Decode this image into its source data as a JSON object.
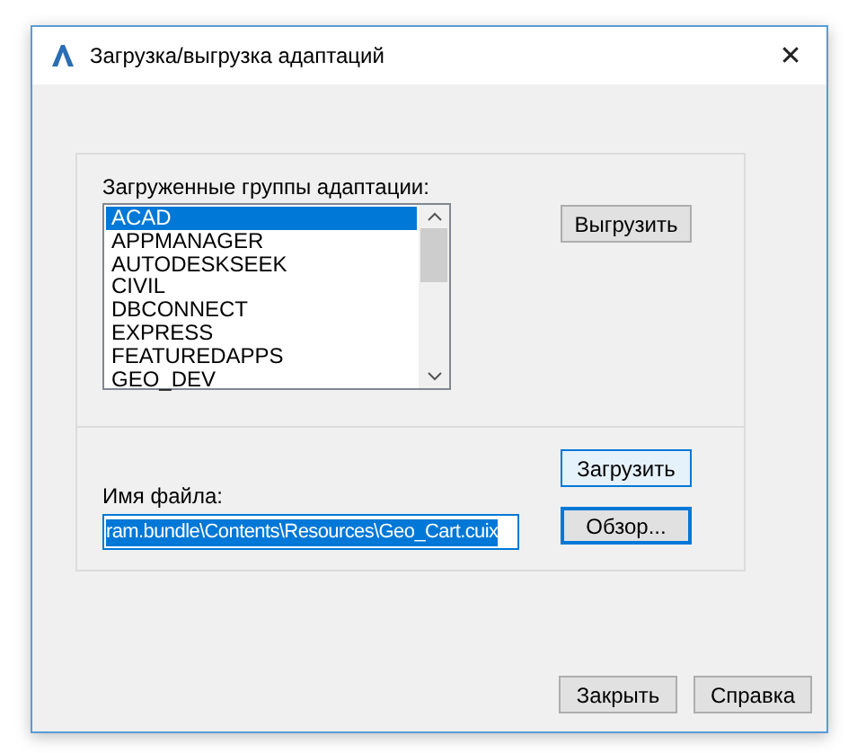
{
  "window": {
    "title": "Загрузка/выгрузка адаптаций",
    "close": "✕"
  },
  "groups": {
    "label": "Загруженные группы адаптации:",
    "items": [
      {
        "text": "ACAD",
        "selected": true
      },
      {
        "text": "APPMANAGER",
        "selected": false
      },
      {
        "text": "AUTODESKSEEK",
        "selected": false
      },
      {
        "text": "CIVIL",
        "selected": false
      },
      {
        "text": "DBCONNECT",
        "selected": false
      },
      {
        "text": "EXPRESS",
        "selected": false
      },
      {
        "text": "FEATUREDAPPS",
        "selected": false
      },
      {
        "text": "GEO_DEV",
        "selected": false
      }
    ],
    "unload_button": "Выгрузить"
  },
  "file": {
    "label": "Имя файла:",
    "value": "ram.bundle\\Contents\\Resources\\Geo_Cart.cuix",
    "load_button": "Загрузить",
    "browse_button": "Обзор..."
  },
  "buttons": [
    "Закрыть",
    "Справка"
  ]
}
